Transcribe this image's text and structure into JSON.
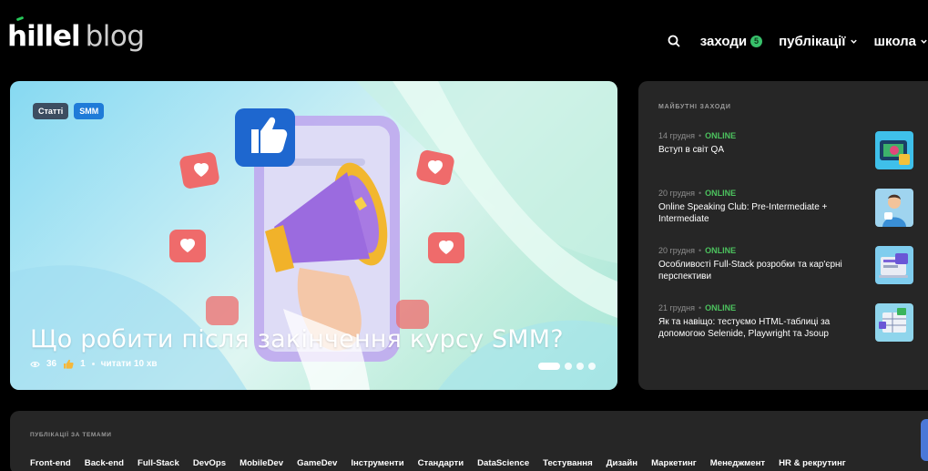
{
  "header": {
    "logo_hillel": "hillel",
    "logo_blog": "blog",
    "nav": {
      "events_label": "заходи",
      "events_badge": "5",
      "publications_label": "публікації",
      "school_label": "школа"
    }
  },
  "hero": {
    "tags": [
      "Статті",
      "SMM"
    ],
    "title": "Що робити після закінчення курсу SMM?",
    "views": "36",
    "likes": "1",
    "read_time": "читати 10 хв",
    "slides": 4,
    "active_slide": 1
  },
  "events": {
    "heading": "МАЙБУТНІ ЗАХОДИ",
    "items": [
      {
        "date": "14 грудня",
        "mode": "ONLINE",
        "title": "Вступ в світ QA",
        "icon": "qa-thumb-icon"
      },
      {
        "date": "20 грудня",
        "mode": "ONLINE",
        "title": "Online Speaking Club: Pre-Intermediate + Intermediate",
        "icon": "speaking-club-thumb-icon"
      },
      {
        "date": "20 грудня",
        "mode": "ONLINE",
        "title": "Особливості Full-Stack розробки та кар'єрні перспективи",
        "icon": "fullstack-thumb-icon"
      },
      {
        "date": "21 грудня",
        "mode": "ONLINE",
        "title": "Як та навіщо: тестуємо HTML-таблиці за допомогою Selenide, Playwright та Jsoup",
        "icon": "html-tables-thumb-icon"
      }
    ]
  },
  "topics": {
    "heading": "ПУБЛІКАЦІЇ ЗА ТЕМАМИ",
    "items": [
      "Front-end",
      "Back-end",
      "Full-Stack",
      "DevOps",
      "MobileDev",
      "GameDev",
      "Інструменти",
      "Стандарти",
      "DataScience",
      "Тестування",
      "Дизайн",
      "Маркетинг",
      "Менеджмент",
      "HR & рекрутинг"
    ]
  },
  "colors": {
    "accent_green": "#38c16b",
    "tag_blue": "#1f7bd8",
    "panel": "#262626"
  }
}
